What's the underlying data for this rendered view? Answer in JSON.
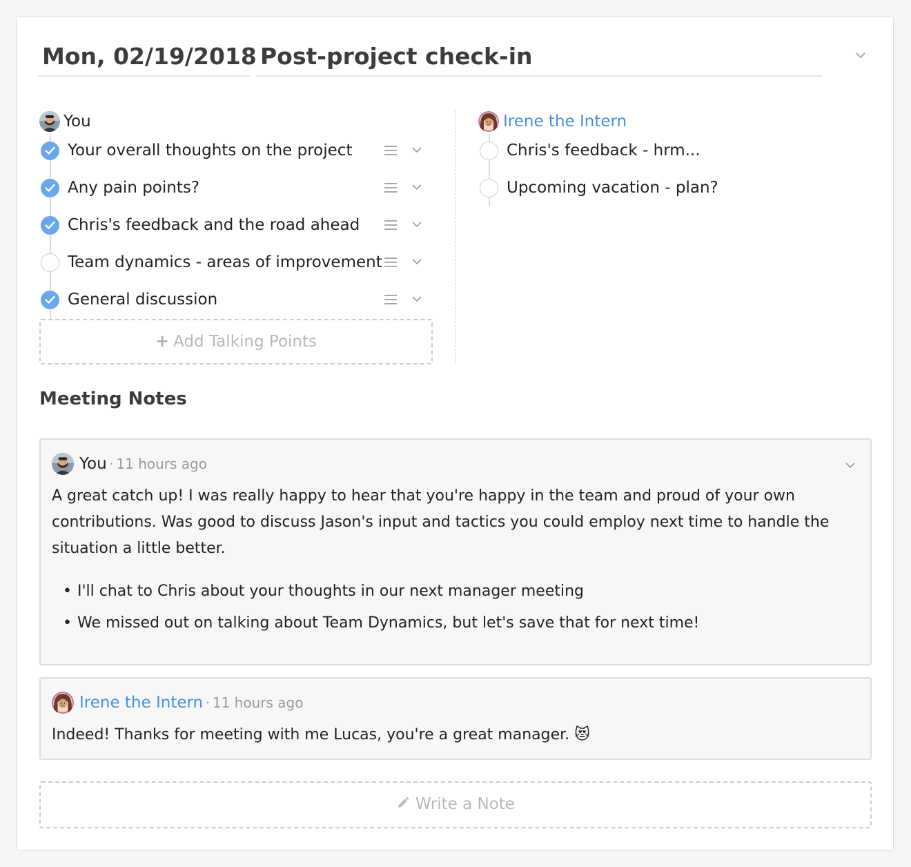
{
  "meeting": {
    "date": "Mon, 02/19/2018",
    "title": "Post-project check-in"
  },
  "columns": {
    "you": {
      "name": "You",
      "talking_points": [
        {
          "text": "Your overall thoughts on the project",
          "done": true
        },
        {
          "text": "Any pain points?",
          "done": true
        },
        {
          "text": "Chris's feedback and the road ahead",
          "done": true
        },
        {
          "text": "Team dynamics - areas of improvement",
          "done": false
        },
        {
          "text": "General discussion",
          "done": true
        }
      ],
      "add_label": "Add Talking Points"
    },
    "irene": {
      "name": "Irene the Intern",
      "talking_points": [
        {
          "text": "Chris's feedback - hrm...",
          "done": false
        },
        {
          "text": "Upcoming vacation - plan?",
          "done": false
        }
      ]
    }
  },
  "notes": {
    "title": "Meeting Notes",
    "items": [
      {
        "author": "You",
        "separator": "·",
        "time": "11 hours ago",
        "body": "A great catch up! I was really happy to hear that you're happy in the team and proud of your own contributions. Was good to discuss Jason's input and tactics you could employ next time to handle the situation a little better.",
        "bullets": [
          "I'll chat to Chris about your thoughts in our next manager meeting",
          "We missed out on talking about Team Dynamics, but let's save that for next time!"
        ]
      },
      {
        "author": "Irene the Intern",
        "separator": "·",
        "time": "11 hours ago",
        "body": "Indeed! Thanks for meeting with me Lucas, you're a great manager. 😻"
      }
    ],
    "write_label": "Write a Note"
  },
  "icons": {
    "check": "check-icon",
    "drag": "drag-handle-icon",
    "chevron": "chevron-down-icon",
    "plus": "plus-icon",
    "pencil": "pencil-icon"
  },
  "colors": {
    "accent": "#4a90d9",
    "check_fill": "#6aa6ee"
  }
}
